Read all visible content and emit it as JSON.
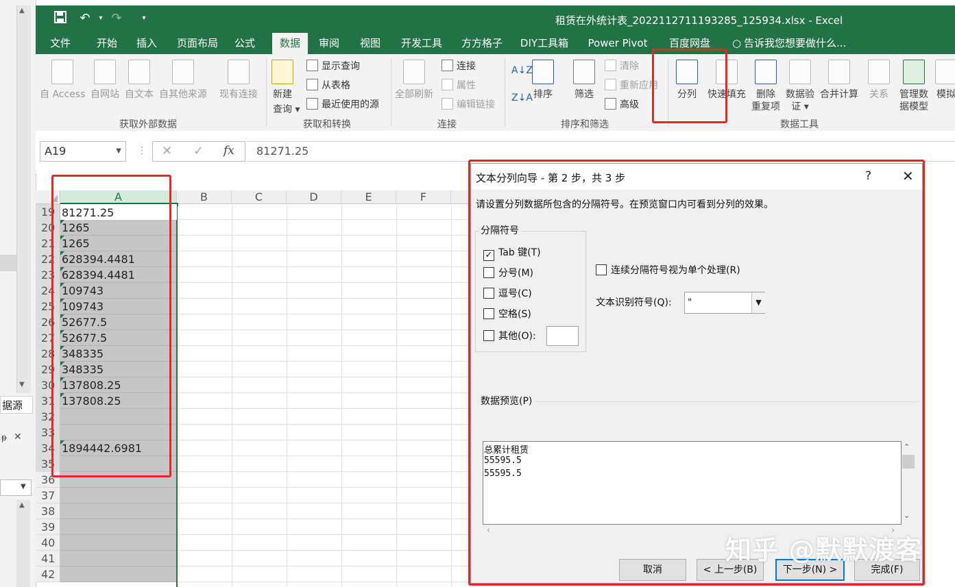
{
  "window": {
    "title": "租赁在外统计表_2022112711193285_125934.xlsx - Excel"
  },
  "left_pane": {
    "label": "据源",
    "pin": "ᵽ",
    "close": "✕"
  },
  "ribbon_tabs": [
    {
      "label": "文件"
    },
    {
      "label": "开始"
    },
    {
      "label": "插入"
    },
    {
      "label": "页面布局"
    },
    {
      "label": "公式"
    },
    {
      "label": "数据",
      "active": true
    },
    {
      "label": "审阅"
    },
    {
      "label": "视图"
    },
    {
      "label": "开发工具"
    },
    {
      "label": "方方格子"
    },
    {
      "label": "DIY工具箱"
    },
    {
      "label": "Power Pivot"
    },
    {
      "label": "百度网盘"
    },
    {
      "label": "告诉我您想要做什么..."
    }
  ],
  "ribbon": {
    "get_external": {
      "label": "获取外部数据",
      "buttons": [
        "自 Access",
        "自网站",
        "自文本",
        "自其他来源",
        "现有连接"
      ]
    },
    "get_transform": {
      "label": "获取和转换",
      "new_query_line1": "新建",
      "new_query_line2": "查询",
      "show_query": "显示查询",
      "from_table": "从表格",
      "recent_sources": "最近使用的源"
    },
    "connections": {
      "label": "连接",
      "refresh_all": "全部刷新",
      "connections": "连接",
      "properties": "属性",
      "edit_links": "编辑链接"
    },
    "sort_filter": {
      "label": "排序和筛选",
      "sort": "排序",
      "filter": "筛选",
      "clear": "清除",
      "reapply": "重新应用",
      "advanced": "高级"
    },
    "data_tools": {
      "label": "数据工具",
      "text_to_columns": "分列",
      "flash_fill": "快速填充",
      "remove_dup_line1": "删除",
      "remove_dup_line2": "重复项",
      "validation_line1": "数据验",
      "validation_line2": "证",
      "consolidate": "合并计算",
      "relationships": "关系",
      "manage_model_line1": "管理数",
      "manage_model_line2": "据模型",
      "whatif": "模拟"
    }
  },
  "formula_bar": {
    "name_box": "A19",
    "cancel": "✕",
    "enter": "✓",
    "fx": "fx",
    "value": "81271.25"
  },
  "sheet": {
    "columns": [
      "A",
      "B",
      "C",
      "D",
      "E",
      "F"
    ],
    "rows": [
      {
        "n": "19",
        "a": "81271.25"
      },
      {
        "n": "20",
        "a": "1265"
      },
      {
        "n": "21",
        "a": "1265"
      },
      {
        "n": "22",
        "a": "628394.4481"
      },
      {
        "n": "23",
        "a": "628394.4481"
      },
      {
        "n": "24",
        "a": "109743"
      },
      {
        "n": "25",
        "a": "109743"
      },
      {
        "n": "26",
        "a": "52677.5"
      },
      {
        "n": "27",
        "a": "52677.5"
      },
      {
        "n": "28",
        "a": "348335"
      },
      {
        "n": "29",
        "a": "348335"
      },
      {
        "n": "30",
        "a": "137808.25"
      },
      {
        "n": "31",
        "a": "137808.25"
      },
      {
        "n": "32",
        "a": ""
      },
      {
        "n": "33",
        "a": ""
      },
      {
        "n": "34",
        "a": "1894442.6981"
      },
      {
        "n": "35",
        "a": ""
      },
      {
        "n": "36",
        "a": ""
      },
      {
        "n": "37",
        "a": ""
      },
      {
        "n": "38",
        "a": ""
      },
      {
        "n": "39",
        "a": ""
      },
      {
        "n": "40",
        "a": ""
      },
      {
        "n": "41",
        "a": ""
      },
      {
        "n": "42",
        "a": ""
      }
    ]
  },
  "dialog": {
    "title": "文本分列向导 - 第 2 步，共 3 步",
    "help": "?",
    "close": "✕",
    "description": "请设置分列数据所包含的分隔符号。在预览窗口内可看到分列的效果。",
    "delimiters_legend": "分隔符号",
    "delimiters": [
      {
        "label": "Tab 键(T)",
        "checked": true
      },
      {
        "label": "分号(M)",
        "checked": false
      },
      {
        "label": "逗号(C)",
        "checked": false
      },
      {
        "label": "空格(S)",
        "checked": false
      },
      {
        "label": "其他(O):",
        "checked": false
      }
    ],
    "consecutive_label": "连续分隔符号视为单个处理(R)",
    "qualifier_label": "文本识别符号(Q):",
    "qualifier_value": "\"",
    "preview_label": "数据预览(P)",
    "preview_lines": [
      "总累计租赁",
      "55595.5",
      "55595.5"
    ],
    "buttons": {
      "cancel": "取消",
      "back": "< 上一步(B)",
      "next": "下一步(N) >",
      "finish": "完成(F)"
    }
  },
  "watermark": "知乎 @默默渡客"
}
